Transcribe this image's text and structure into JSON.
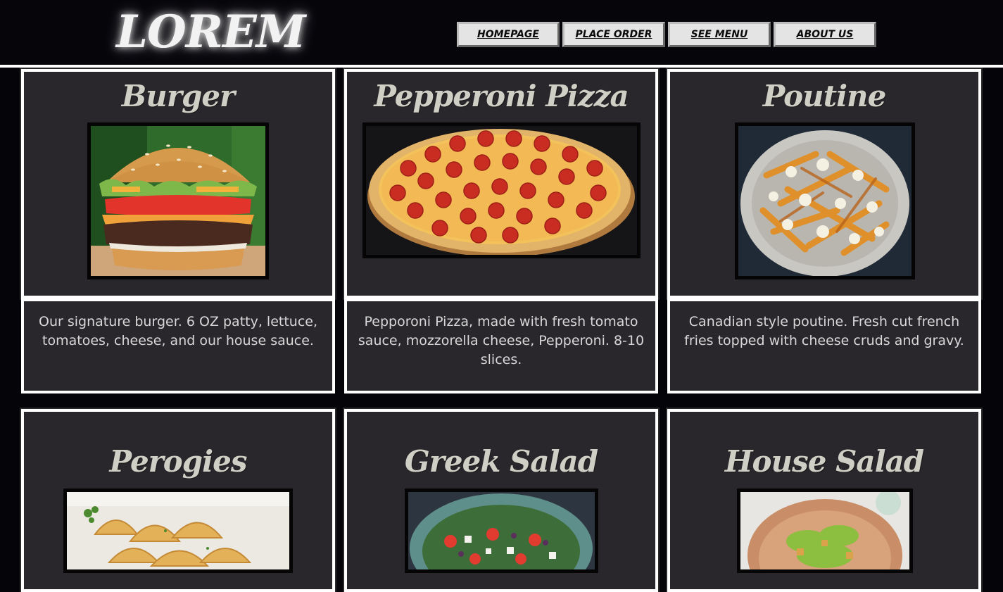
{
  "header": {
    "logo": "LOREM",
    "nav": [
      "HOMEPAGE",
      "PLACE ORDER",
      "SEE MENU",
      "ABOUT US"
    ]
  },
  "menu": {
    "items": [
      {
        "title": "Burger",
        "description": "Our signature burger. 6 OZ patty, lettuce, tomatoes, cheese, and our house sauce."
      },
      {
        "title": "Pepperoni Pizza",
        "description": "Pepporoni Pizza, made with fresh tomato sauce, mozzorella cheese, Pepperoni. 8-10 slices."
      },
      {
        "title": "Poutine",
        "description": "Canadian style poutine. Fresh cut french fries topped with cheese cruds and gravy."
      },
      {
        "title": "Perogies"
      },
      {
        "title": "Greek Salad"
      },
      {
        "title": "House Salad"
      }
    ]
  },
  "colors": {
    "background": "#050409",
    "card": "#29272b",
    "border": "#ffffff",
    "title": "#cfcfc6"
  }
}
